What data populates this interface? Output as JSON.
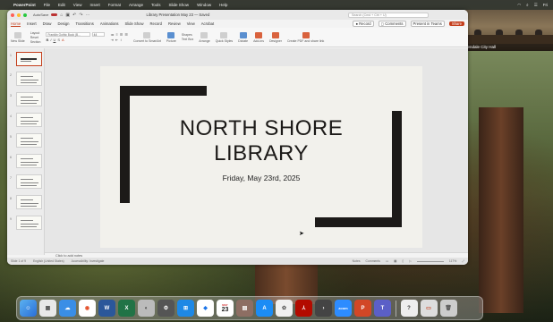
{
  "menubar": {
    "app": "PowerPoint",
    "items": [
      "File",
      "Edit",
      "View",
      "Insert",
      "Format",
      "Arrange",
      "Tools",
      "Slide Show",
      "Window",
      "Help"
    ],
    "clock": "Fri"
  },
  "video": {
    "label": "Glendale City Hall"
  },
  "window": {
    "autosave_label": "AutoSave",
    "doc_title": "Library Presentation May 23 — Saved",
    "search_placeholder": "Search (Cmd + Ctrl + U)",
    "tabs": [
      "Home",
      "Insert",
      "Draw",
      "Design",
      "Transitions",
      "Animations",
      "Slide Show",
      "Record",
      "Review",
      "View",
      "Acrobat"
    ],
    "record_label": "Record",
    "comments_label": "Comments",
    "teams_label": "Present in Teams",
    "share_label": "Share"
  },
  "ribbon": {
    "new_slide": "New Slide",
    "layout": "Layout",
    "reset": "Reset",
    "section": "Section",
    "font_name": "Franklin Gothic Book (B...",
    "font_size": "44",
    "convert_smartart": "Convert to SmartArt",
    "picture": "Picture",
    "shapes": "Shapes",
    "text_box": "Text Box",
    "arrange": "Arrange",
    "quick_styles": "Quick Styles",
    "dictate": "Dictate",
    "add_ins": "Add-ins",
    "designer": "Designer",
    "create_pdf": "Create PDF and share link"
  },
  "thumbnails": [
    "1",
    "2",
    "3",
    "4",
    "5",
    "6",
    "7",
    "8",
    "9"
  ],
  "slide": {
    "title_line1": "NORTH SHORE",
    "title_line2": "LIBRARY",
    "subtitle": "Friday, May 23rd, 2025"
  },
  "notes_placeholder": "Click to add notes",
  "status": {
    "slide_count": "Slide 1 of 9",
    "language": "English (United States)",
    "accessibility": "Accessibility: Investigate",
    "notes": "Notes",
    "comments": "Comments",
    "zoom": "117%"
  },
  "dock": {
    "calendar_month": "MAY",
    "calendar_day": "23"
  },
  "colors": {
    "accent": "#c43e1c",
    "slide_bg": "#f2f1ec",
    "slide_ink": "#1c1a18"
  }
}
